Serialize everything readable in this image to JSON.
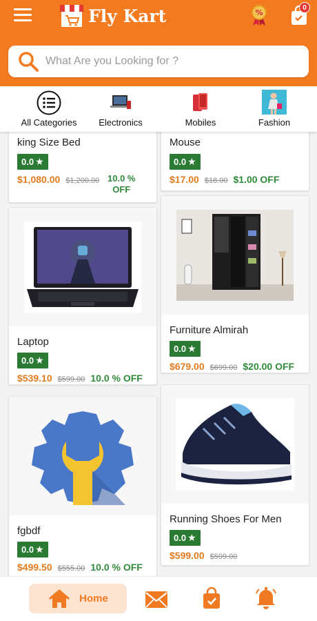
{
  "header": {
    "app_title": "Fly Kart",
    "cart_count": "0",
    "brand_color": "#f47a20",
    "icons": [
      "menu-icon",
      "shop-logo-icon",
      "offer-badge-icon",
      "shopping-bag-icon"
    ]
  },
  "search": {
    "placeholder": "What Are you Looking for ?",
    "value": ""
  },
  "categories": [
    {
      "label": "All Categories",
      "icon": "list-icon"
    },
    {
      "label": "Electronics",
      "icon": "electronics-icon"
    },
    {
      "label": "Mobiles",
      "icon": "mobiles-icon"
    },
    {
      "label": "Fashion",
      "icon": "fashion-icon"
    }
  ],
  "products": [
    {
      "name": "king Size Bed",
      "rating": "0.0",
      "price": "$1,080.00",
      "mrp": "$1,200.00",
      "off": "10.0 % OFF",
      "off_line1": "10.0 %",
      "off_line2": "OFF"
    },
    {
      "name": "Mouse",
      "rating": "0.0",
      "price": "$17.00",
      "mrp": "$18.00",
      "off": "$1.00 OFF"
    },
    {
      "name": "Laptop",
      "rating": "0.0",
      "price": "$539.10",
      "mrp": "$599.00",
      "off": "10.0 % OFF"
    },
    {
      "name": "Furniture Almirah",
      "rating": "0.0",
      "price": "$679.00",
      "mrp": "$699.00",
      "off": "$20.00 OFF"
    },
    {
      "name": "fgbdf",
      "rating": "0.0",
      "price": "$499.50",
      "mrp": "$555.00",
      "off": "10.0 % OFF"
    },
    {
      "name": "Running Shoes For Men",
      "rating": "0.0",
      "price": "$599.00",
      "mrp": "$599.00",
      "off": ""
    }
  ],
  "bottom_nav": {
    "home_label": "Home",
    "accent": "#f07a22",
    "items": [
      "home-icon",
      "mail-icon",
      "shopping-bag-icon",
      "bell-icon"
    ]
  }
}
